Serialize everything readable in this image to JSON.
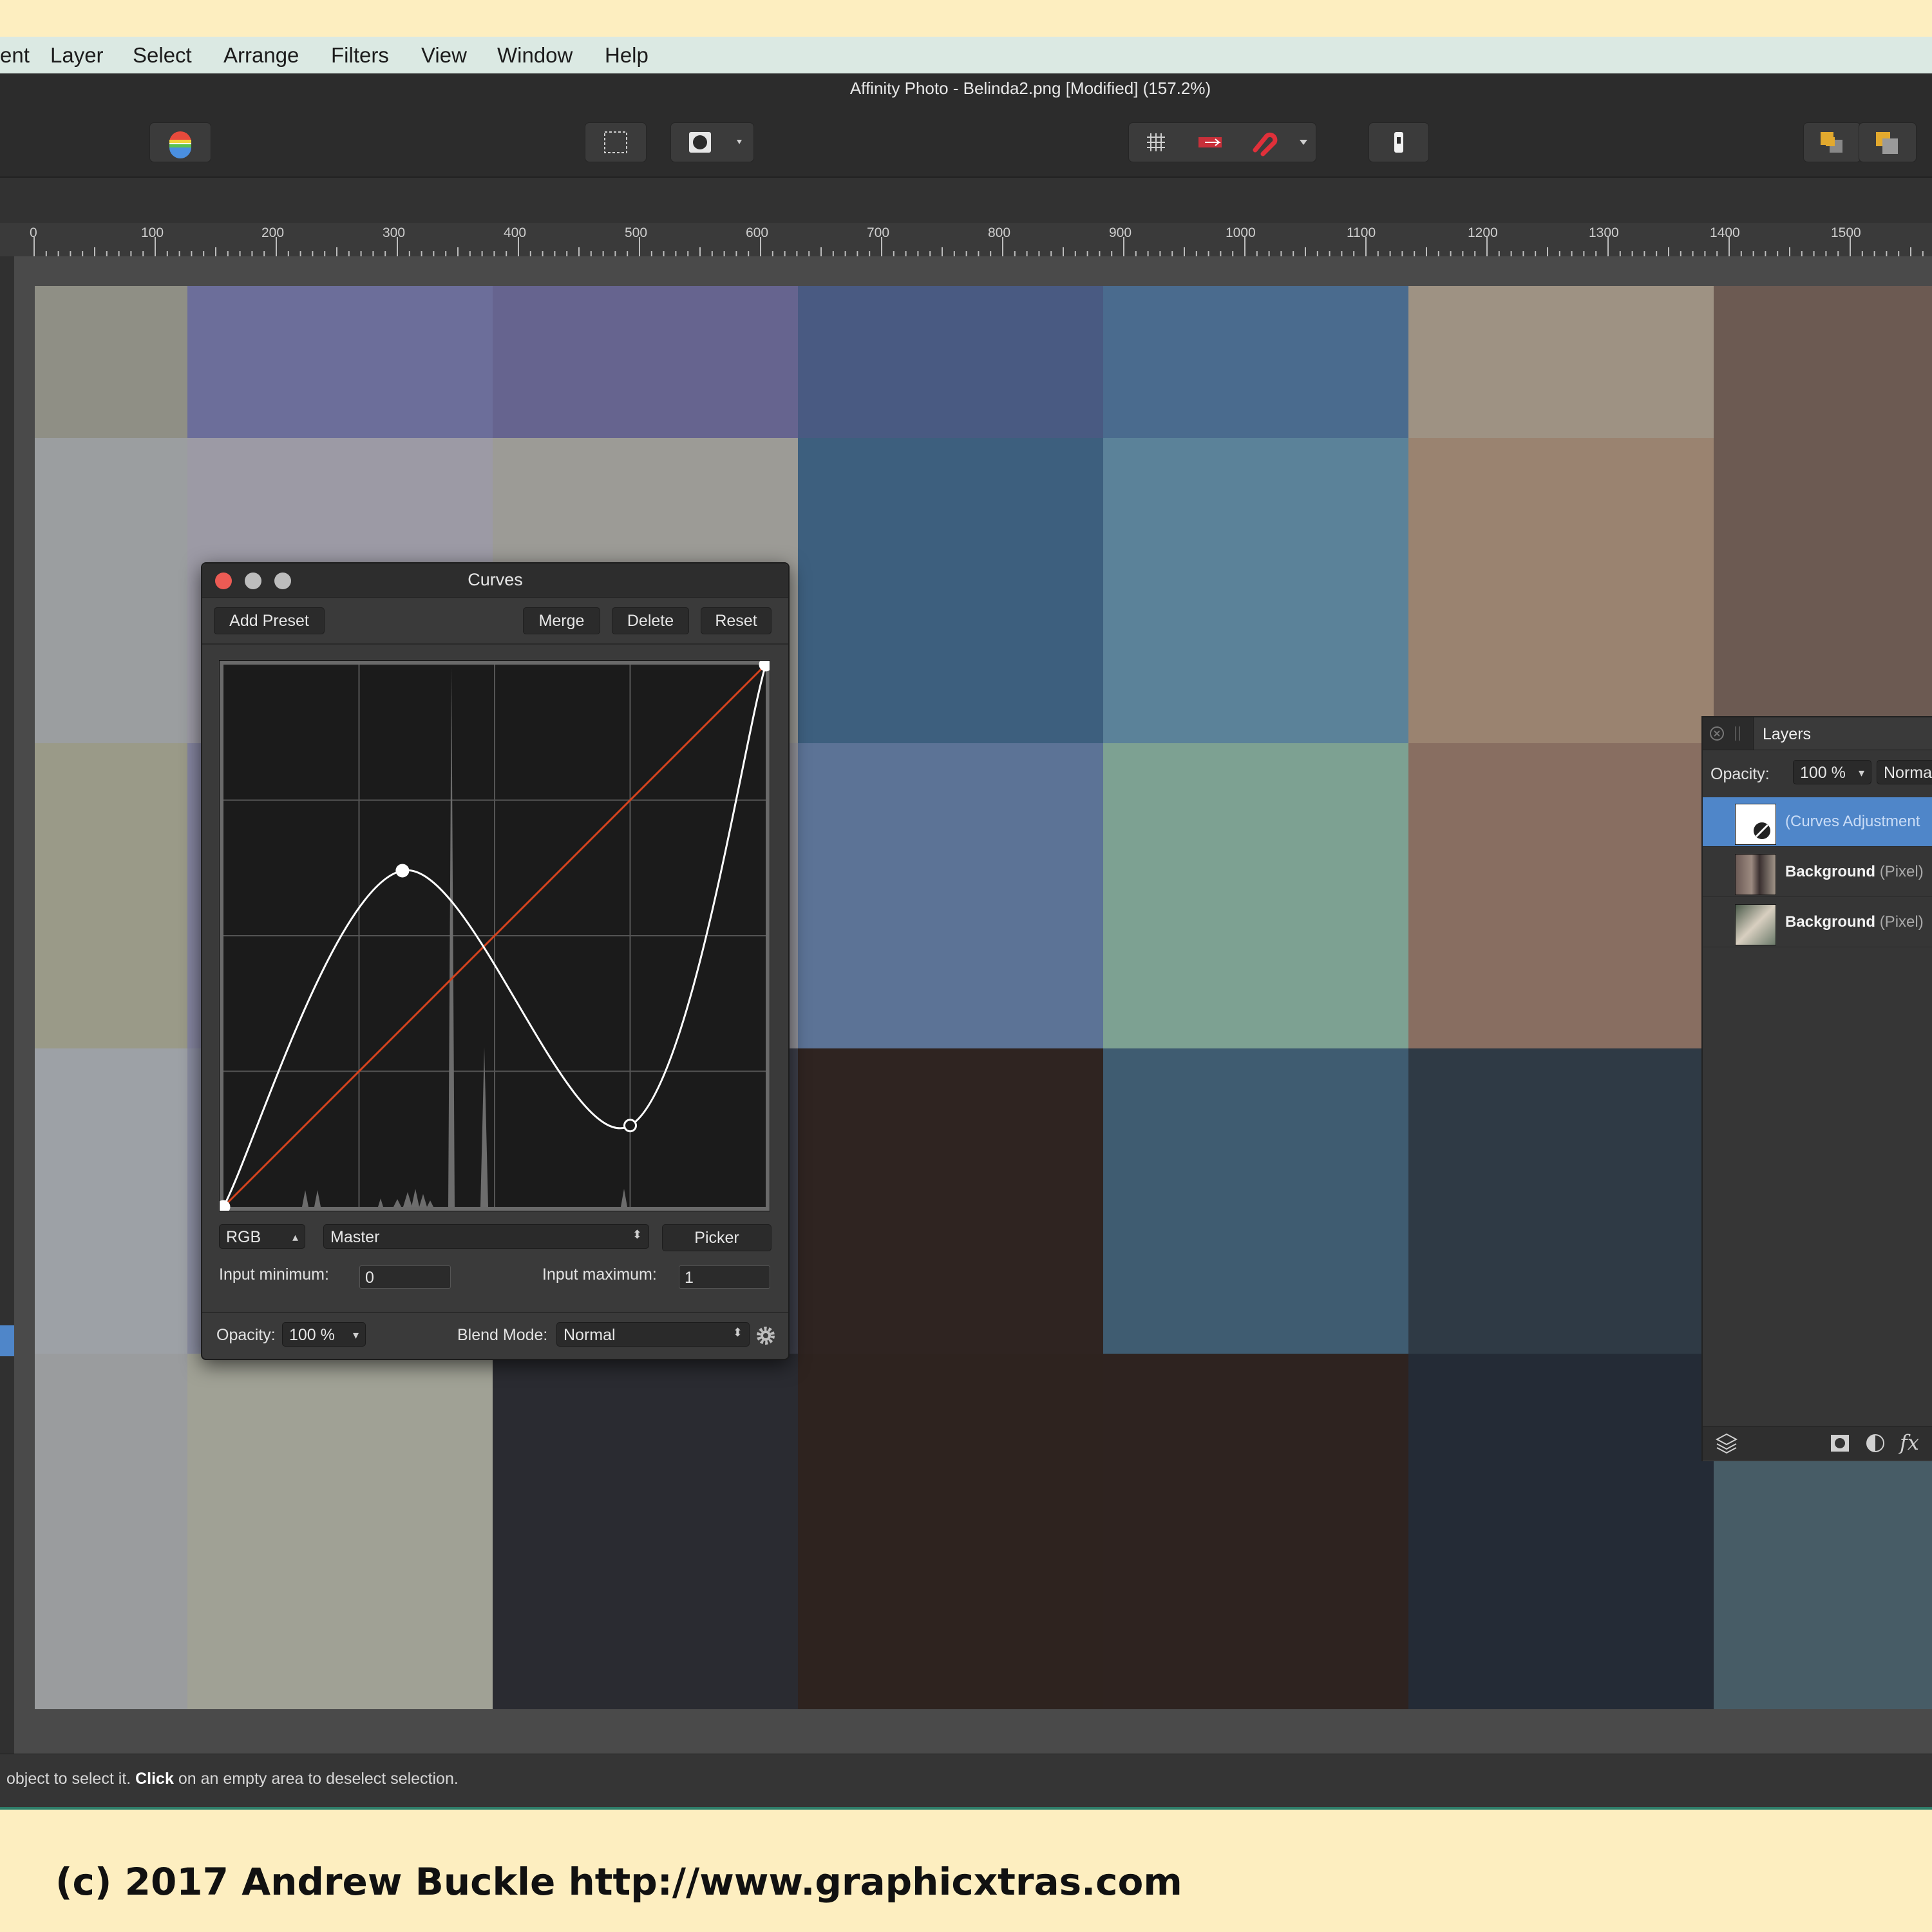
{
  "menu": [
    "ent",
    "Layer",
    "Select",
    "Arrange",
    "Filters",
    "View",
    "Window",
    "Help"
  ],
  "window_title": "Affinity Photo - Belinda2.png [Modified] (157.2%)",
  "ruler_labels": [
    "0",
    "100",
    "200",
    "300",
    "400",
    "500",
    "600",
    "700",
    "800",
    "900",
    "1000",
    "1100",
    "1200",
    "1300",
    "1400",
    "1500"
  ],
  "curves": {
    "title": "Curves",
    "add_preset": "Add Preset",
    "merge": "Merge",
    "delete": "Delete",
    "reset": "Reset",
    "color_model": "RGB",
    "channel": "Master",
    "picker": "Picker",
    "input_min_label": "Input minimum:",
    "input_min_value": "0",
    "input_max_label": "Input maximum:",
    "input_max_value": "1",
    "opacity_label": "Opacity:",
    "opacity_value": "100 %",
    "blend_label": "Blend Mode:",
    "blend_value": "Normal",
    "curve_points": [
      [
        0,
        0
      ],
      [
        0.33,
        0.62
      ],
      [
        0.75,
        0.15
      ],
      [
        1,
        1
      ]
    ],
    "curve_color": "#ffffff",
    "diagonal_color": "#d4431e"
  },
  "layers": {
    "tab": "Layers",
    "opacity_label": "Opacity:",
    "opacity_value": "100 %",
    "blend_value": "Normal",
    "items": [
      {
        "name": "(Curves Adjustment",
        "kind": ""
      },
      {
        "name": "Background",
        "kind": "(Pixel)"
      },
      {
        "name": "Background",
        "kind": "(Pixel)"
      }
    ],
    "fx_label": "fx"
  },
  "status": {
    "pre": "object to select it. ",
    "bold": "Click",
    "post": " on an empty area to deselect selection."
  },
  "footer": "(c) 2017 Andrew Buckle http://www.graphicxtras.com",
  "colors": {
    "selected_layer": "#4f86c9",
    "close_dot": "#ec5b54",
    "accent_status": "#2e7e6a"
  }
}
